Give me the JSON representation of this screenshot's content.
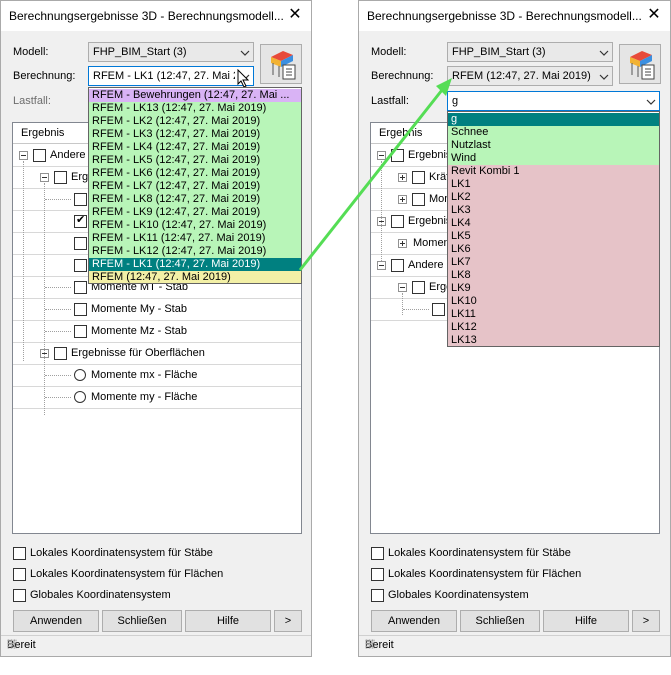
{
  "colors": {
    "purple_item": "#d9b3f5",
    "green_item": "#b8f5b8",
    "selected_item": "#008080",
    "yellow_item": "#f3f0a6",
    "red_item": "#e6c3c8",
    "arrow": "#55dd55"
  },
  "left": {
    "title": "Berechnungsergebnisse 3D - Berechnungsmodell...",
    "modell_label": "Modell:",
    "modell_value": "FHP_BIM_Start (3)",
    "berechnung_label": "Berechnung:",
    "berechnung_value": "RFEM - LK1 (12:47, 27. Mai 2(",
    "lastfall_label": "Lastfall:",
    "tree_header": "Ergebnis",
    "tree": {
      "andere": "Andere",
      "ergeb": "Ergeb",
      "mt": "Momente MT - Stab",
      "my": "Momente My - Stab",
      "mz": "Momente Mz - Stab",
      "oberflaechen": "Ergebnisse für Oberflächen",
      "mx_flaeche": "Momente mx - Fläche",
      "my_flaeche": "Momente my - Fläche"
    },
    "dropdown": [
      {
        "label": "RFEM - Bewehrungen (12:47, 27. Mai ...",
        "kind": "purple"
      },
      {
        "label": "RFEM - LK13 (12:47, 27. Mai 2019)",
        "kind": "green"
      },
      {
        "label": "RFEM - LK2 (12:47, 27. Mai 2019)",
        "kind": "green"
      },
      {
        "label": "RFEM - LK3 (12:47, 27. Mai 2019)",
        "kind": "green"
      },
      {
        "label": "RFEM - LK4 (12:47, 27. Mai 2019)",
        "kind": "green"
      },
      {
        "label": "RFEM - LK5 (12:47, 27. Mai 2019)",
        "kind": "green"
      },
      {
        "label": "RFEM - LK6 (12:47, 27. Mai 2019)",
        "kind": "green"
      },
      {
        "label": "RFEM - LK7 (12:47, 27. Mai 2019)",
        "kind": "green"
      },
      {
        "label": "RFEM - LK8 (12:47, 27. Mai 2019)",
        "kind": "green"
      },
      {
        "label": "RFEM - LK9 (12:47, 27. Mai 2019)",
        "kind": "green"
      },
      {
        "label": "RFEM - LK10 (12:47, 27. Mai 2019)",
        "kind": "green"
      },
      {
        "label": "RFEM - LK11 (12:47, 27. Mai 2019)",
        "kind": "green"
      },
      {
        "label": "RFEM - LK12 (12:47, 27. Mai 2019)",
        "kind": "green"
      },
      {
        "label": "RFEM - LK1 (12:47, 27. Mai 2019)",
        "kind": "selected"
      },
      {
        "label": "RFEM (12:47, 27. Mai 2019)",
        "kind": "yellow"
      }
    ]
  },
  "right": {
    "title": "Berechnungsergebnisse 3D - Berechnungsmodell...",
    "modell_label": "Modell:",
    "modell_value": "FHP_BIM_Start (3)",
    "berechnung_label": "Berechnung:",
    "berechnung_value": "RFEM (12:47, 27. Mai 2019)",
    "lastfall_label": "Lastfall:",
    "lastfall_value": "g",
    "tree_header": "Ergebnis",
    "tree": {
      "ergebnis1": "Ergebnis",
      "kraft": "Kräft",
      "mom": "Mom",
      "ergebnis2": "Ergebnis",
      "moment": "Moment",
      "andere": "Andere",
      "erge": "Erge"
    },
    "dropdown": [
      {
        "label": "g",
        "kind": "selected"
      },
      {
        "label": "Schnee",
        "kind": "green"
      },
      {
        "label": "Nutzlast",
        "kind": "green"
      },
      {
        "label": "Wind",
        "kind": "green"
      },
      {
        "label": "Revit Kombi 1",
        "kind": "red"
      },
      {
        "label": "LK1",
        "kind": "red"
      },
      {
        "label": "LK2",
        "kind": "red"
      },
      {
        "label": "LK3",
        "kind": "red"
      },
      {
        "label": "LK4",
        "kind": "red"
      },
      {
        "label": "LK5",
        "kind": "red"
      },
      {
        "label": "LK6",
        "kind": "red"
      },
      {
        "label": "LK7",
        "kind": "red"
      },
      {
        "label": "LK8",
        "kind": "red"
      },
      {
        "label": "LK9",
        "kind": "red"
      },
      {
        "label": "LK10",
        "kind": "red"
      },
      {
        "label": "LK11",
        "kind": "red"
      },
      {
        "label": "LK12",
        "kind": "red"
      },
      {
        "label": "LK13",
        "kind": "red"
      }
    ]
  },
  "common": {
    "cb_staebe": "Lokales Koordinatensystem für Stäbe",
    "cb_flaechen": "Lokales Koordinatensystem für Flächen",
    "cb_global": "Globales Koordinatensystem",
    "btn_anwenden": "Anwenden",
    "btn_schliessen": "Schließen",
    "btn_hilfe": "Hilfe",
    "btn_more": ">",
    "status": "Bereit",
    "close_glyph": "✕"
  }
}
